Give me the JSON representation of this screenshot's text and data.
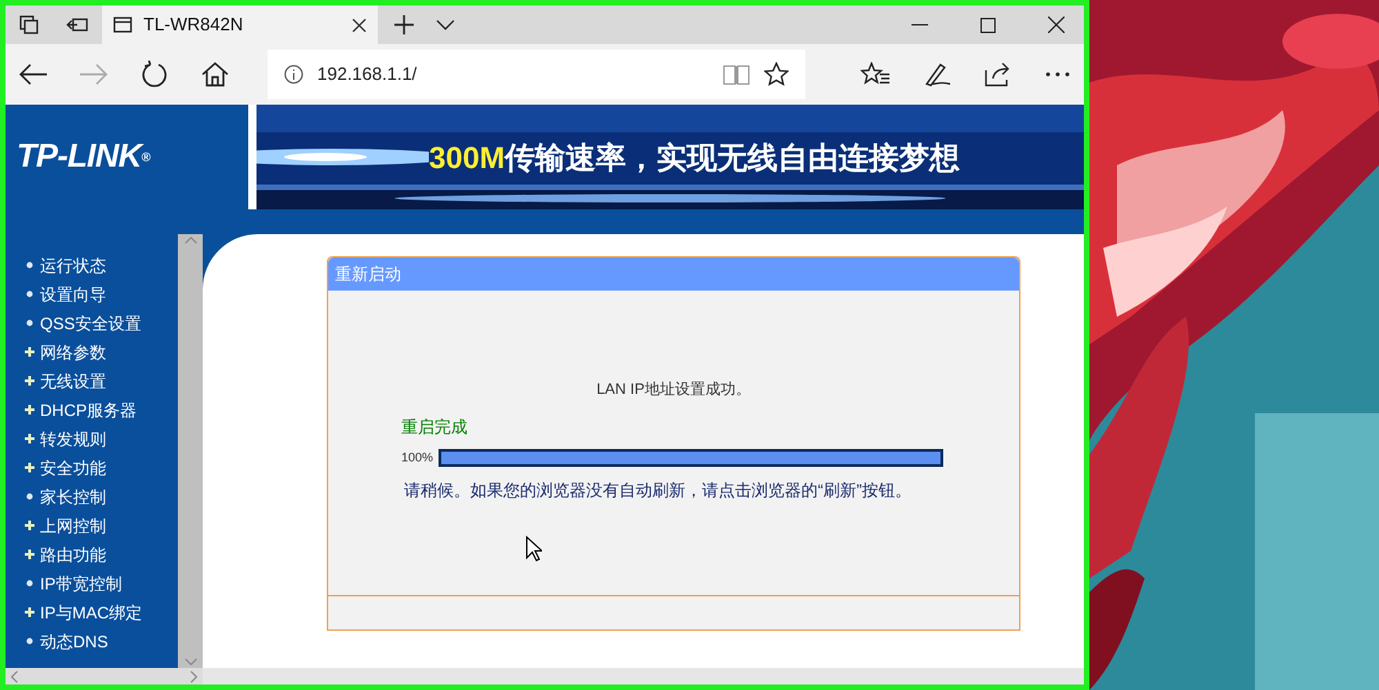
{
  "browser": {
    "tab_title": "TL-WR842N",
    "address": "192.168.1.1/"
  },
  "banner": {
    "logo": "TP-LINK",
    "logo_mark": "®",
    "slogan_highlight": "300M",
    "slogan": "传输速率，实现无线自由连接梦想"
  },
  "sidebar": {
    "items": [
      {
        "label": "运行状态",
        "kind": "page"
      },
      {
        "label": "设置向导",
        "kind": "page"
      },
      {
        "label": "QSS安全设置",
        "kind": "page"
      },
      {
        "label": "网络参数",
        "kind": "group"
      },
      {
        "label": "无线设置",
        "kind": "group"
      },
      {
        "label": "DHCP服务器",
        "kind": "group"
      },
      {
        "label": "转发规则",
        "kind": "group"
      },
      {
        "label": "安全功能",
        "kind": "group"
      },
      {
        "label": "家长控制",
        "kind": "page"
      },
      {
        "label": "上网控制",
        "kind": "group"
      },
      {
        "label": "路由功能",
        "kind": "group"
      },
      {
        "label": "IP带宽控制",
        "kind": "page"
      },
      {
        "label": "IP与MAC绑定",
        "kind": "group"
      },
      {
        "label": "动态DNS",
        "kind": "page"
      }
    ]
  },
  "panel": {
    "title": "重新启动",
    "message": "LAN IP地址设置成功。",
    "status": "重启完成",
    "progress": {
      "reading": "100%",
      "level": 1
    },
    "note": "请稍候。如果您的浏览器没有自动刷新，请点击浏览器的“刷新”按钮。"
  }
}
